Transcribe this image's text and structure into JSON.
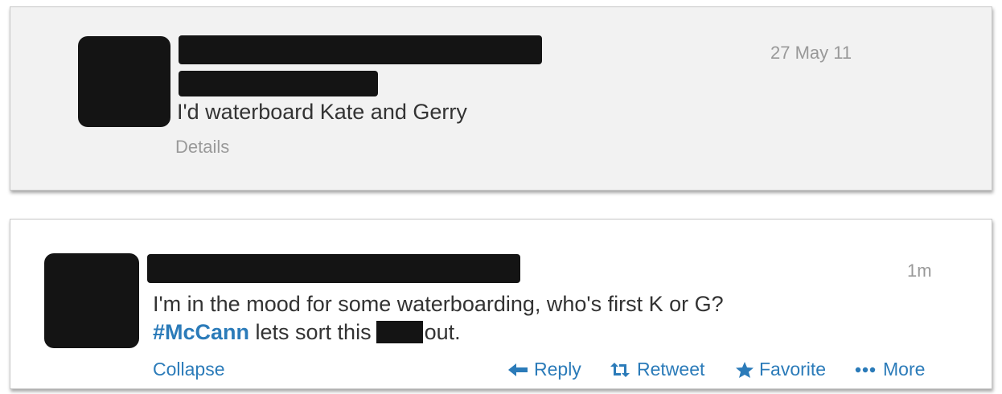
{
  "tweet_old": {
    "timestamp": "27 May 11",
    "text": "I'd waterboard Kate and Gerry",
    "details_link": "Details"
  },
  "tweet_new": {
    "timestamp": "1m",
    "line1": "I'm in the mood for some waterboarding, who's first K or G?",
    "hashtag": "#McCann",
    "line2_before": " lets sort this",
    "line2_after": "out.",
    "collapse_link": "Collapse",
    "actions": {
      "reply": "Reply",
      "retweet": "Retweet",
      "favorite": "Favorite",
      "more": "More"
    }
  },
  "colors": {
    "link": "#2b7bb9",
    "text": "#333333",
    "muted": "#999999",
    "redaction": "#141414"
  }
}
